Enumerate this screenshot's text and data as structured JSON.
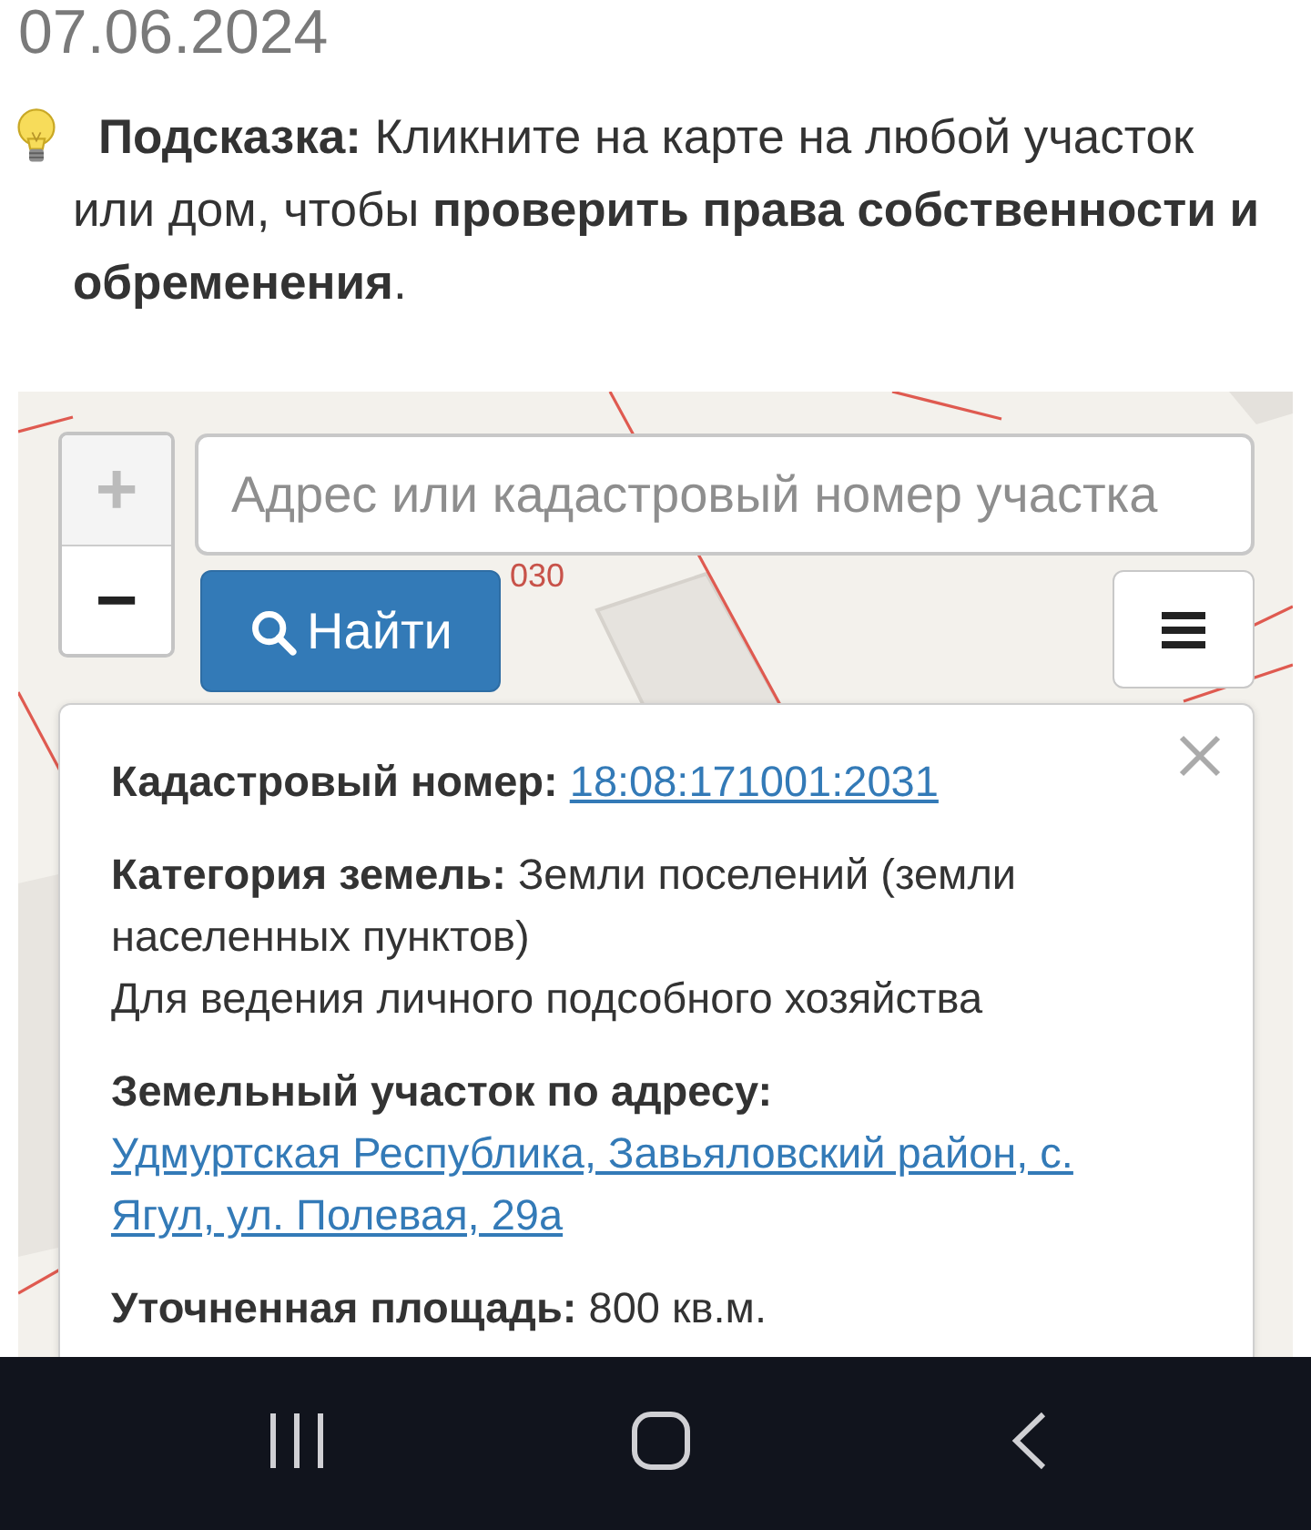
{
  "date": "07.06.2024",
  "hint": {
    "text": "**Подсказка:** Кликните на карте на любой участок или дом, чтобы **проверить права собственности и обременения**."
  },
  "map": {
    "parcel_label": "030",
    "zoom_controls": [
      {
        "label": "+",
        "disabled": true
      },
      {
        "label": "−",
        "disabled": false
      }
    ],
    "search": {
      "placeholder": "Адрес или кадастровый номер участка"
    },
    "search_button": "Найти"
  },
  "popup": {
    "rows": [
      {
        "kind": "link",
        "label": "Кадастровый номер:",
        "value": "18:08:171001:2031"
      },
      {
        "kind": "text",
        "label": "Категория земель:",
        "value": "Земли поселений (земли населенных пунктов)",
        "note": "Для ведения личного подсобного хозяйства"
      },
      {
        "kind": "address",
        "label": "Земельный участок по адресу:",
        "value": "Удмуртская Республика, Завьяловский район, с. Ягул, ул. Полевая, 29а"
      },
      {
        "kind": "text",
        "label": "Уточненная площадь:",
        "value": "800 кв.м."
      }
    ]
  }
}
